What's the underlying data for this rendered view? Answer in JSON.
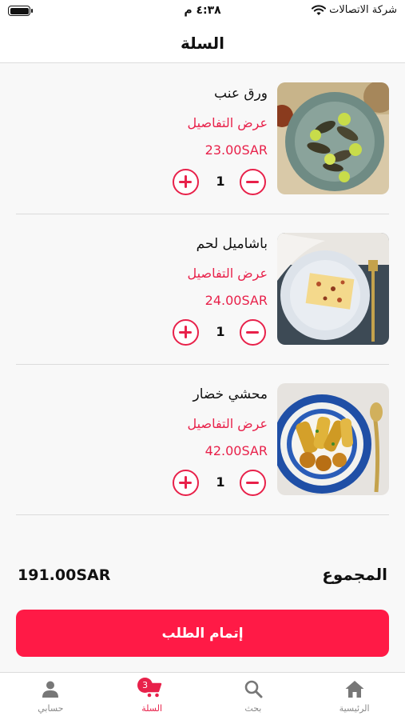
{
  "status_bar": {
    "time": "٤:٣٨ م",
    "carrier": "شركة الاتصالات"
  },
  "header": {
    "title": "السلة"
  },
  "cart": {
    "details_label": "عرض التفاصيل",
    "items": [
      {
        "name": "ورق عنب",
        "price": "23.00SAR",
        "quantity": "1",
        "image": "vine-leaves-dish"
      },
      {
        "name": "باشاميل لحم",
        "price": "24.00SAR",
        "quantity": "1",
        "image": "bechamel-meat-dish"
      },
      {
        "name": "محشي خضار",
        "price": "42.00SAR",
        "quantity": "1",
        "image": "stuffed-vegetables-dish"
      }
    ]
  },
  "summary": {
    "total_label": "المجموع",
    "total_amount": "191.00SAR"
  },
  "checkout": {
    "label": "إتمام الطلب"
  },
  "tabbar": {
    "tabs": [
      {
        "label": "حسابي",
        "icon": "person-icon"
      },
      {
        "label": "السلة",
        "icon": "cart-icon",
        "badge": "3",
        "active": true
      },
      {
        "label": "بحث",
        "icon": "search-icon"
      },
      {
        "label": "الرئيسية",
        "icon": "home-icon"
      }
    ]
  },
  "colors": {
    "accent": "#e8214a",
    "button": "#ff1a46",
    "background": "#f8f8f8"
  }
}
